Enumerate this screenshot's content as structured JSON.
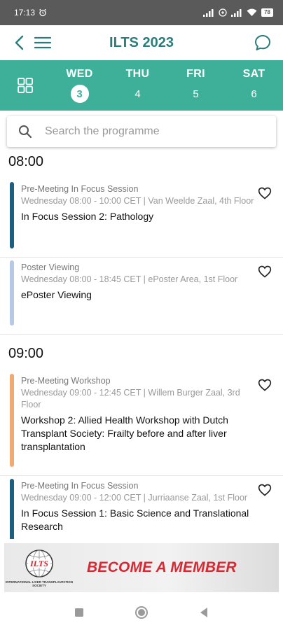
{
  "status_bar": {
    "time": "17:13",
    "battery": "78"
  },
  "app_bar": {
    "title": "ILTS 2023"
  },
  "day_tabs": [
    {
      "day": "WED",
      "date": "3",
      "active": true
    },
    {
      "day": "THU",
      "date": "4",
      "active": false
    },
    {
      "day": "FRI",
      "date": "5",
      "active": false
    },
    {
      "day": "SAT",
      "date": "6",
      "active": false
    }
  ],
  "search": {
    "placeholder": "Search the programme"
  },
  "schedule": {
    "time_0800": "08:00",
    "time_0900": "09:00",
    "sessions": [
      {
        "type": "Pre-Meeting In Focus Session",
        "meta": "Wednesday 08:00 - 10:00 CET | Van Weelde Zaal, 4th Floor",
        "title": "In Focus Session 2: Pathology",
        "color": "#1e5f7f"
      },
      {
        "type": "Poster Viewing",
        "meta": "Wednesday 08:00 - 18:45 CET | ePoster Area, 1st Floor",
        "title": "ePoster Viewing",
        "color": "#b7c9e6"
      },
      {
        "type": "Pre-Meeting Workshop",
        "meta": "Wednesday 09:00 - 12:45 CET | Willem Burger Zaal, 3rd Floor",
        "title": "Workshop 2: Allied Health Workshop with Dutch Transplant Society: Frailty before and after liver transplantation",
        "color": "#f0aa74"
      },
      {
        "type": "Pre-Meeting In Focus Session",
        "meta": "Wednesday 09:00 - 12:00 CET | Jurriaanse Zaal, 1st Floor",
        "title": "In Focus Session 1: Basic Science and Translational Research",
        "color": "#1e5f7f"
      }
    ]
  },
  "banner": {
    "logo_text": "ILTS",
    "logo_subtext": "INTERNATIONAL LIVER TRANSPLANTATION SOCIETY",
    "cta": "BECOME A MEMBER"
  },
  "colors": {
    "accent": "#2a7d7b",
    "tab_bg": "#3eb09a",
    "cta": "#d42a33"
  }
}
